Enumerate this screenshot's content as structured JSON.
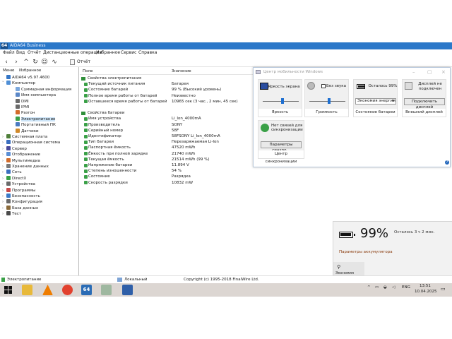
{
  "window": {
    "title": "AIDA64 Business",
    "app_icon": "64"
  },
  "menu": [
    "Файл",
    "Вид",
    "Отчёт",
    "Дистанционные операции",
    "Избранное",
    "Сервис",
    "Справка"
  ],
  "toolbar": {
    "report_label": "Отчёт"
  },
  "left_panel": {
    "tabs": [
      "Меню",
      "Избранное"
    ],
    "tree": [
      {
        "label": "AIDA64 v5.97.4600",
        "level": 0,
        "icon": "aida64-icon",
        "expander": ""
      },
      {
        "label": "Компьютер",
        "level": 0,
        "icon": "computer-icon",
        "expander": "v"
      },
      {
        "label": "Суммарная информация",
        "level": 1,
        "icon": "summary-icon",
        "expander": ""
      },
      {
        "label": "Имя компьютера",
        "level": 1,
        "icon": "computer-name-icon",
        "expander": ""
      },
      {
        "label": "DMI",
        "level": 1,
        "icon": "dmi-icon",
        "expander": ""
      },
      {
        "label": "IPMI",
        "level": 1,
        "icon": "ipmi-icon",
        "expander": ""
      },
      {
        "label": "Разгон",
        "level": 1,
        "icon": "overclock-icon",
        "expander": ""
      },
      {
        "label": "Электропитание",
        "level": 1,
        "icon": "power-icon",
        "expander": "",
        "selected": true
      },
      {
        "label": "Портативный ПК",
        "level": 1,
        "icon": "laptop-icon",
        "expander": ""
      },
      {
        "label": "Датчики",
        "level": 1,
        "icon": "sensor-icon",
        "expander": ""
      },
      {
        "label": "Системная плата",
        "level": 0,
        "icon": "motherboard-icon",
        "expander": ">"
      },
      {
        "label": "Операционная система",
        "level": 0,
        "icon": "os-icon",
        "expander": ">"
      },
      {
        "label": "Сервер",
        "level": 0,
        "icon": "server-icon",
        "expander": ">"
      },
      {
        "label": "Отображение",
        "level": 0,
        "icon": "display-icon",
        "expander": ">"
      },
      {
        "label": "Мультимедиа",
        "level": 0,
        "icon": "multimedia-icon",
        "expander": ">"
      },
      {
        "label": "Хранение данных",
        "level": 0,
        "icon": "storage-icon",
        "expander": ">"
      },
      {
        "label": "Сеть",
        "level": 0,
        "icon": "network-icon",
        "expander": ">"
      },
      {
        "label": "DirectX",
        "level": 0,
        "icon": "directx-icon",
        "expander": ">"
      },
      {
        "label": "Устройства",
        "level": 0,
        "icon": "devices-icon",
        "expander": ">"
      },
      {
        "label": "Программы",
        "level": 0,
        "icon": "programs-icon",
        "expander": ">"
      },
      {
        "label": "Безопасность",
        "level": 0,
        "icon": "security-icon",
        "expander": ">"
      },
      {
        "label": "Конфигурация",
        "level": 0,
        "icon": "config-icon",
        "expander": ">"
      },
      {
        "label": "База данных",
        "level": 0,
        "icon": "database-icon",
        "expander": ">"
      },
      {
        "label": "Тест",
        "level": 0,
        "icon": "benchmark-icon",
        "expander": ">"
      }
    ]
  },
  "columns": {
    "field": "Поле",
    "value": "Значение"
  },
  "sections": [
    {
      "title": "Свойства электропитания",
      "rows": [
        {
          "field": "Текущий источник питания",
          "value": "Батарея"
        },
        {
          "field": "Состояние батарей",
          "value": "99 % (Высокий уровень)"
        },
        {
          "field": "Полное время работы от батарей",
          "value": "Неизвестно"
        },
        {
          "field": "Оставшееся время работы от батарей",
          "value": "10965 сек (3 час., 2 мин, 45 сек)"
        }
      ]
    },
    {
      "title": "Свойства батареи",
      "rows": [
        {
          "field": "Имя устройства",
          "value": "Li_Ion_4000mA"
        },
        {
          "field": "Производитель",
          "value": "SONY"
        },
        {
          "field": "Серийный номер",
          "value": "58F"
        },
        {
          "field": "Идентификатор",
          "value": "58FSONY Li_Ion_4000mA"
        },
        {
          "field": "Тип батареи",
          "value": "Перезаряжаемая Li-Ion"
        },
        {
          "field": "Паспортная ёмкость",
          "value": "47520 mWh"
        },
        {
          "field": "Ёмкость при полной зарядке",
          "value": "21740 mWh"
        },
        {
          "field": "Текущая ёмкость",
          "value": "21514 mWh  (99 %)"
        },
        {
          "field": "Напряжение батареи",
          "value": "11.894 V"
        },
        {
          "field": "Степень изношенности",
          "value": "54 %"
        },
        {
          "field": "Состояние",
          "value": "Разрядка"
        },
        {
          "field": "Скорость разрядки",
          "value": "10832 mW"
        }
      ]
    }
  ],
  "mobility_center": {
    "title": "Центр мобильности Windows",
    "brightness": {
      "label": "Яркость экрана",
      "name": "Яркость",
      "level_pct": 55
    },
    "volume": {
      "mute_label": "Без звука",
      "name": "Громкость",
      "level_pct": 55
    },
    "battery": {
      "status": "Осталось 99%",
      "plan": "Экономия энергии",
      "name": "Состояние батареи"
    },
    "display": {
      "status": "Дисплей не подключен",
      "button": "Подключить дисплей",
      "name": "Внешний дисплей"
    },
    "sync": {
      "status": "Нет связей для синхронизации",
      "button": "Параметры синхро...",
      "name": "Центр синхронизации"
    }
  },
  "battery_flyout": {
    "percent": "99%",
    "remaining": "Осталось 3 ч 2 мин.",
    "link": "Параметры аккумулятора",
    "eco_label": "Экономия заряда",
    "level_pct": 99
  },
  "statusbar": {
    "left": "Электропитание",
    "mid": "Локальный",
    "copyright": "Copyright (c) 1995-2018 FinalWire Ltd."
  },
  "taskbar": {
    "lang": "ENG",
    "time": "13:51",
    "date": "10.04.2025"
  },
  "colors": {
    "titlebar": "#2b78c9",
    "selection": "#cce4f7",
    "accent_link": "#8a3c0e",
    "taskbar": "#dcd6d2"
  }
}
